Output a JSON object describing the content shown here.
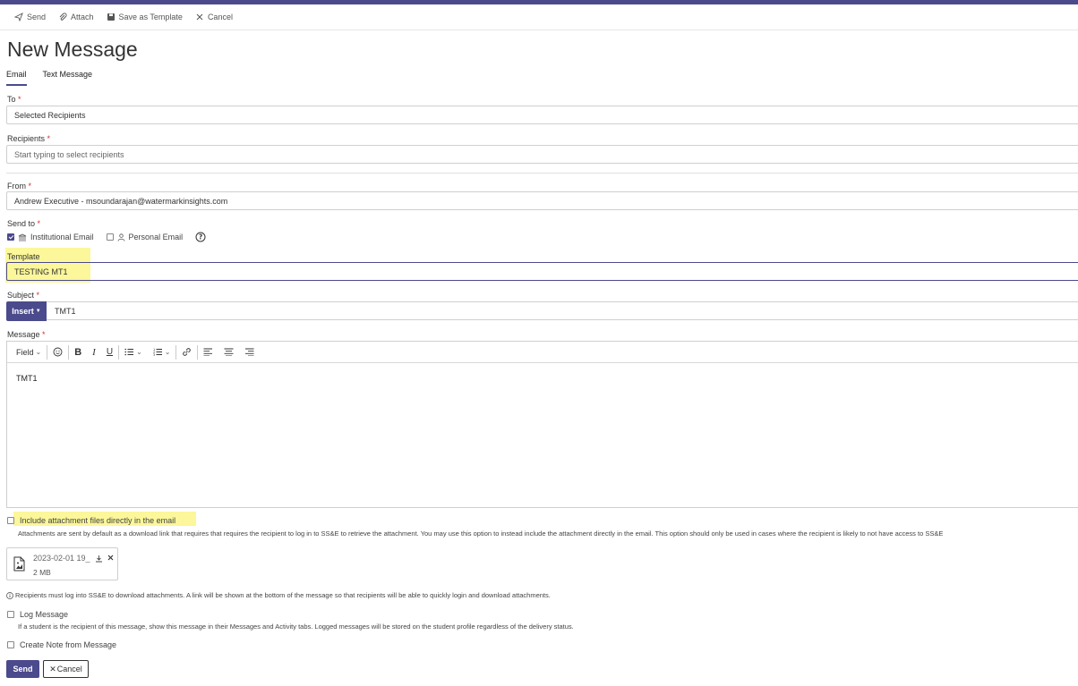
{
  "toolbar": {
    "send": "Send",
    "attach": "Attach",
    "save_template": "Save as Template",
    "cancel": "Cancel"
  },
  "page_title": "New Message",
  "tabs": [
    {
      "label": "Email",
      "active": true
    },
    {
      "label": "Text Message",
      "active": false
    }
  ],
  "fields": {
    "to": {
      "label": "To",
      "value": "Selected Recipients"
    },
    "recipients": {
      "label": "Recipients",
      "placeholder": "Start typing to select recipients"
    },
    "from": {
      "label": "From",
      "value": "Andrew Executive - msoundarajan@watermarkinsights.com"
    },
    "send_to": {
      "label": "Send to",
      "institutional": "Institutional Email",
      "personal": "Personal Email",
      "institutional_checked": true,
      "personal_checked": false
    },
    "template": {
      "label": "Template",
      "value": "TESTING MT1"
    },
    "subject": {
      "label": "Subject",
      "insert": "Insert",
      "value": "TMT1"
    },
    "message": {
      "label": "Message",
      "field_menu": "Field",
      "body": "TMT1"
    }
  },
  "required_mark": "*",
  "attachments": {
    "include_label": "Include attachment files directly in the email",
    "include_help": "Attachments are sent by default as a download link that requires that requires the recipient to log in to SS&E to retrieve the attachment. You may use this option to instead include the attachment directly in the email. This option should only be used in cases where the recipient is likely to not have access to SS&E",
    "file_name": "2023-02-01 19_",
    "file_size": "2 MB",
    "notice": "Recipients must log into SS&E to download attachments. A link will be shown at the bottom of the message so that recipients will be able to quickly login and download attachments."
  },
  "log_message": {
    "label": "Log Message",
    "help": "If a student is the recipient of this message, show this message in their Messages and Activity tabs. Logged messages will be stored on the student profile regardless of the delivery status."
  },
  "create_note": {
    "label": "Create Note from Message"
  },
  "footer": {
    "send": "Send",
    "cancel": "Cancel"
  },
  "colors": {
    "brand": "#4b4a8c",
    "highlight": "#fbf79a",
    "required": "#cc3333"
  }
}
